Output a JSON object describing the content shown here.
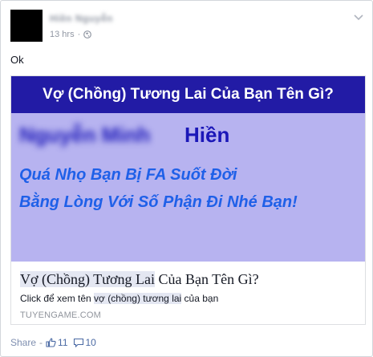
{
  "post": {
    "author": "Hiền Nguyễn",
    "timestamp": "13 hrs",
    "separator": "·",
    "privacy_icon": "globe-icon",
    "text": "Ok"
  },
  "attachment": {
    "banner_title": "Vợ (Chồng) Tương Lai Của Bạn Tên Gì?",
    "name_blurred": "Nguyễn Minh",
    "name_visible": "Hiền",
    "line1": "Quá Nhọ Bạn Bị FA Suốt Đời",
    "line2": "Bằng Lòng Với Số Phận Đi Nhé Bạn!",
    "title_highlight": "Vợ (Chồng) Tương Lai",
    "title_rest": " Của Bạn Tên Gì?",
    "desc_prefix": "Click để xem tên ",
    "desc_highlight": "vợ (chồng) tương lai",
    "desc_suffix": " của bạn",
    "domain": "TUYENGAME.COM"
  },
  "actions": {
    "share_label": "Share",
    "separator": "-",
    "likes": "11",
    "comments": "10"
  },
  "colors": {
    "banner_header": "#221ba5",
    "banner_bg": "#b7b3f0",
    "name_color": "#1b17b8",
    "line_color": "#1f60e8",
    "link_color": "#4b6aa4"
  }
}
